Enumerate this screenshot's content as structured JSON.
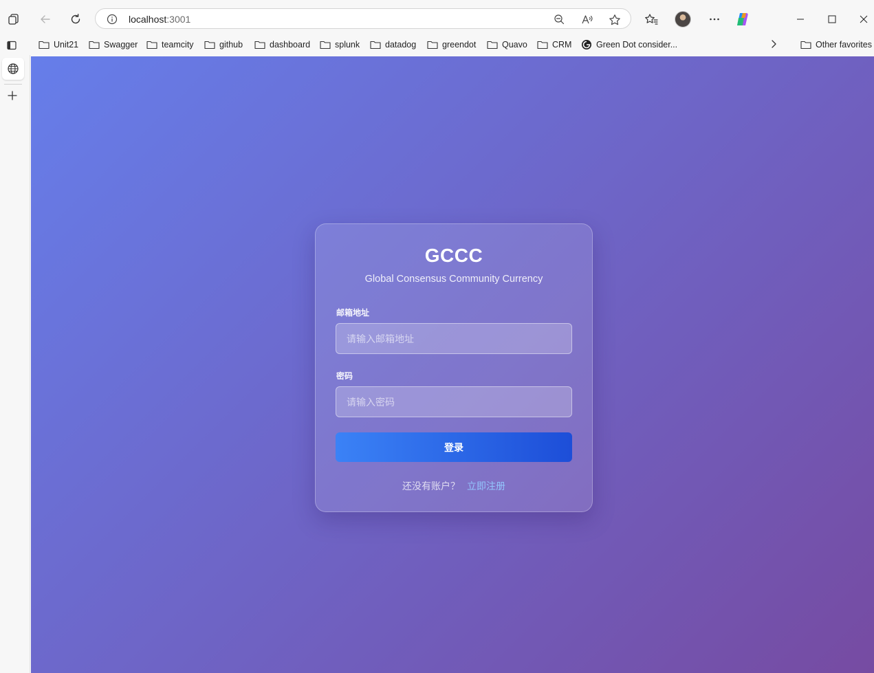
{
  "browser": {
    "address_bar": {
      "host": "localhost",
      "port": ":3001"
    }
  },
  "favorites": {
    "items": [
      {
        "label": "Unit21",
        "icon": "folder-icon"
      },
      {
        "label": "Swagger",
        "icon": "folder-icon"
      },
      {
        "label": "teamcity",
        "icon": "folder-icon"
      },
      {
        "label": "github",
        "icon": "folder-icon"
      },
      {
        "label": "dashboard",
        "icon": "folder-icon"
      },
      {
        "label": "splunk",
        "icon": "folder-icon"
      },
      {
        "label": "datadog",
        "icon": "folder-icon"
      },
      {
        "label": "greendot",
        "icon": "folder-icon"
      },
      {
        "label": "Quavo",
        "icon": "folder-icon"
      },
      {
        "label": "CRM",
        "icon": "folder-icon"
      },
      {
        "label": "Green Dot consider...",
        "icon": "site-logo-icon"
      }
    ],
    "other": "Other favorites"
  },
  "login": {
    "title": "GCCC",
    "subtitle": "Global Consensus Community Currency",
    "email_label": "邮箱地址",
    "email_placeholder": "请输入邮箱地址",
    "email_value": "",
    "password_label": "密码",
    "password_placeholder": "请输入密码",
    "password_value": "",
    "submit_label": "登录",
    "no_account_text": "还没有账户？",
    "register_link": "立即注册"
  },
  "colors": {
    "page_gradient_start": "#667eea",
    "page_gradient_end": "#764ba2",
    "button_start": "#3b82f6",
    "button_end": "#1d4ed8",
    "link": "#93c5fd"
  }
}
